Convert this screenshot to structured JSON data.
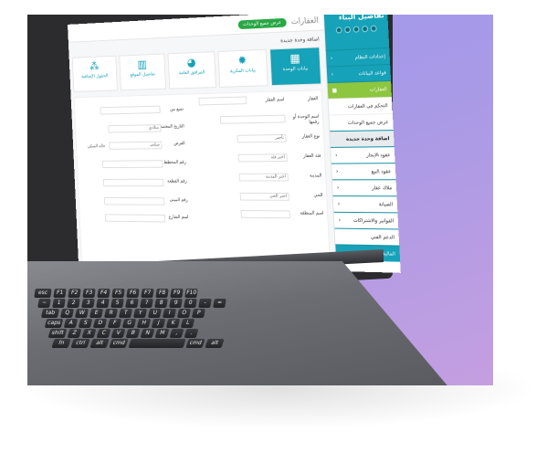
{
  "app": {
    "title": "العقارات",
    "view_all": "عرض جميع الوحدات",
    "breadcrumb": "اضافة وحدة جديدة"
  },
  "sidebar": {
    "header": "تفاصيل البناء",
    "items": [
      {
        "label": "إعدادات النظام"
      },
      {
        "label": "قواعد البيانات"
      },
      {
        "label": "العقارات"
      },
      {
        "label": "التحكم في العقارات"
      },
      {
        "label": "عرض جميع الوحدات"
      },
      {
        "label": "اضافة وحدة جديدة"
      },
      {
        "label": "عقود الايجار"
      },
      {
        "label": "عقود البيع"
      },
      {
        "label": "ملاك عقار"
      },
      {
        "label": "الصيانة"
      },
      {
        "label": "الفواتير والاشتراكات"
      },
      {
        "label": "الدعم الفني"
      },
      {
        "label": "المالية"
      }
    ]
  },
  "tabs": [
    {
      "label": "بيانات الوحدة",
      "icon": "building-icon"
    },
    {
      "label": "بيانات المكرية",
      "icon": "gear-icon"
    },
    {
      "label": "المرافق العامة",
      "icon": "palette-icon"
    },
    {
      "label": "تفاصيل الموقع",
      "icon": "map-icon"
    },
    {
      "label": "الحقول الإضافية",
      "icon": "cubes-icon"
    }
  ],
  "form": {
    "fields": [
      {
        "label": "العقار",
        "value": ""
      },
      {
        "label": "اسم العقار",
        "value": ""
      },
      {
        "label": "تسع من",
        "value": ""
      },
      {
        "label": "اسم الوحدة أو رقمها",
        "value": ""
      },
      {
        "label": "التاريخ المعتمد",
        "value": "ميلادي"
      },
      {
        "label": "نوع العقار",
        "value": "تأجير"
      },
      {
        "label": "الغرض",
        "value": "سكني"
      },
      {
        "label": "فئة العقار",
        "value": "اختر فئة"
      },
      {
        "label": "رقم المخطط",
        "value": ""
      },
      {
        "label": "المدينة",
        "value": "اختر المدينة"
      },
      {
        "label": "رقم القطعة",
        "value": ""
      },
      {
        "label": "الحي",
        "value": "اختر الحي"
      },
      {
        "label": "رقم المبنى",
        "value": ""
      },
      {
        "label": "اسم المنطقة",
        "value": ""
      },
      {
        "label": "اسم الشارع",
        "value": ""
      }
    ],
    "unit_status": "حالة السكن"
  },
  "keyboard": {
    "rows": [
      [
        "esc",
        "F1",
        "F2",
        "F3",
        "F4",
        "F5",
        "F6",
        "F7",
        "F8",
        "F9",
        "F10"
      ],
      [
        "~",
        "1",
        "2",
        "3",
        "4",
        "5",
        "6",
        "7",
        "8",
        "9",
        "0",
        "-",
        "="
      ],
      [
        "tab",
        "Q",
        "W",
        "E",
        "R",
        "T",
        "Y",
        "U",
        "I",
        "O",
        "P"
      ],
      [
        "caps",
        "A",
        "S",
        "D",
        "F",
        "G",
        "H",
        "J",
        "K",
        "L"
      ],
      [
        "shift",
        "Z",
        "X",
        "C",
        "V",
        "B",
        "N",
        "M",
        ",",
        "."
      ],
      [
        "fn",
        "ctrl",
        "alt",
        "cmd",
        "",
        "cmd",
        "alt"
      ]
    ]
  },
  "colors": {
    "primary": "#16a2b8",
    "accent": "#8dc63f",
    "success": "#28a745",
    "background_gradient_start": "#9f97ee",
    "background_gradient_end": "#c49fe0"
  }
}
